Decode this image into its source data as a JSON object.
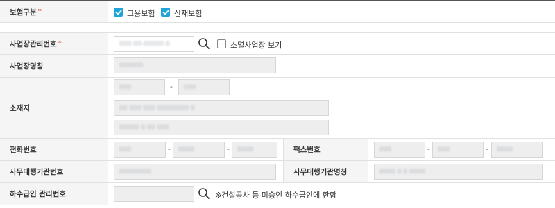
{
  "insurance_type": {
    "label": "보험구분",
    "required_mark": "*",
    "options": [
      {
        "label": "고용보험",
        "checked": true
      },
      {
        "label": "산재보험",
        "checked": true
      }
    ]
  },
  "workplace_mgmt_no": {
    "label": "사업장관리번호",
    "required_mark": "*",
    "value": "000-00-00000-0",
    "show_closed_label": "소멸사업장 보기",
    "show_closed_checked": false
  },
  "workplace_name": {
    "label": "사업장명칭",
    "value": "000000"
  },
  "address": {
    "label": "소재지",
    "postal_1": "000",
    "postal_2": "000",
    "separator": "-",
    "line1": "00 000 000 00000000 0",
    "line2": "00000 0 00 000"
  },
  "phone": {
    "label": "전화번호",
    "parts": [
      "000",
      "0000",
      "0000"
    ],
    "separator": "-"
  },
  "fax": {
    "label": "팩스번호",
    "parts": [
      "000",
      "000",
      "0000"
    ],
    "separator": "-"
  },
  "agency_no": {
    "label": "사무대행기관번호",
    "value": "00000000"
  },
  "agency_name": {
    "label": "사무대행기관명칭",
    "value": "0000 0 0 0000"
  },
  "subcontractor_no": {
    "label": "하수급인 관리번호",
    "value": "",
    "note": "※건설공사 등 미승인 하수급인에 한함"
  },
  "colors": {
    "checkbox_on": "#1fa4d8",
    "required": "#e8403a",
    "label_bg": "#f5f5f5",
    "input_disabled_bg": "#eeeeee"
  },
  "icons": {
    "search": "magnifier-icon",
    "check": "checkmark-icon"
  }
}
